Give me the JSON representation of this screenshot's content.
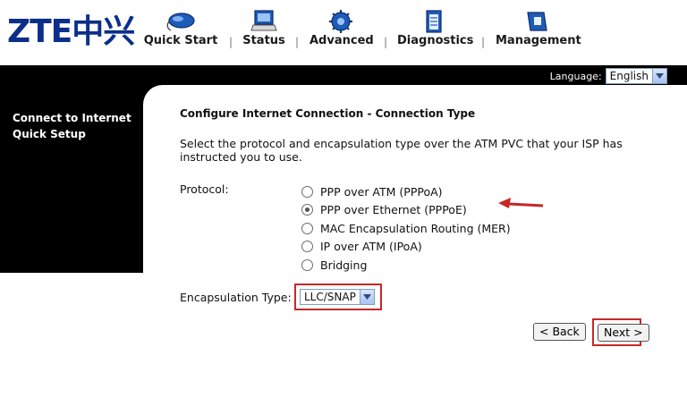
{
  "header": {
    "logo_text": "ZTE中兴",
    "nav": [
      {
        "label": "Quick Start",
        "icon": "mouse-icon"
      },
      {
        "label": "Status",
        "icon": "monitor-icon"
      },
      {
        "label": "Advanced",
        "icon": "gear-icon"
      },
      {
        "label": "Diagnostics",
        "icon": "clipboard-icon"
      },
      {
        "label": "Management",
        "icon": "folder-icon"
      }
    ],
    "separator": "|"
  },
  "language": {
    "label": "Language:",
    "value": "English"
  },
  "sidebar": {
    "title": "Connect to Internet Quick Setup"
  },
  "main": {
    "title": "Configure Internet Connection - Connection Type",
    "description": "Select the protocol and encapsulation type over the ATM PVC that your ISP has instructed you to use.",
    "protocol_label": "Protocol:",
    "protocols": [
      {
        "label": "PPP over ATM (PPPoA)",
        "checked": false
      },
      {
        "label": "PPP over Ethernet (PPPoE)",
        "checked": true
      },
      {
        "label": "MAC Encapsulation Routing (MER)",
        "checked": false
      },
      {
        "label": "IP over ATM (IPoA)",
        "checked": false
      },
      {
        "label": "Bridging",
        "checked": false
      }
    ],
    "encapsulation_label": "Encapsulation Type:",
    "encapsulation_value": "LLC/SNAP",
    "back_label": "< Back",
    "next_label": "Next >"
  },
  "colors": {
    "brand": "#0b2f8a",
    "highlight": "#c62828",
    "band": "#000000"
  }
}
